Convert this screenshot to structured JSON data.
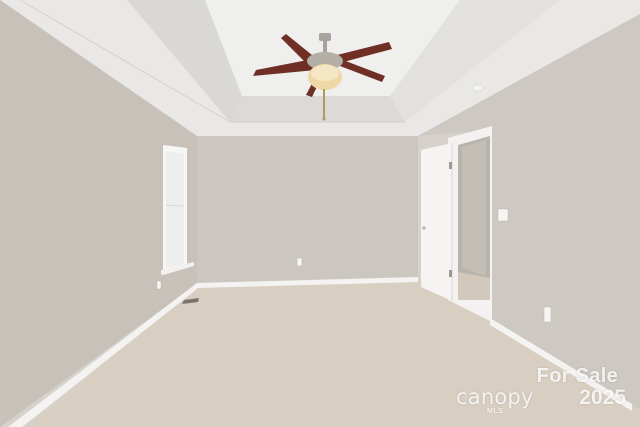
{
  "photo": {
    "subject": "empty-bedroom",
    "colors": {
      "wall_left": "#c7c1ba",
      "wall_back": "#cbc6bf",
      "wall_right": "#cdc8c1",
      "ceiling": "#e9e8e6",
      "carpet": "#d8cfc2",
      "trim": "#f4f3f1",
      "fan_blade": "#6f2f24",
      "fan_metal": "#a7a39c"
    }
  },
  "watermark": {
    "for_sale": "For Sale",
    "brand": "canopy",
    "year": "2025",
    "mls": "MLS"
  }
}
